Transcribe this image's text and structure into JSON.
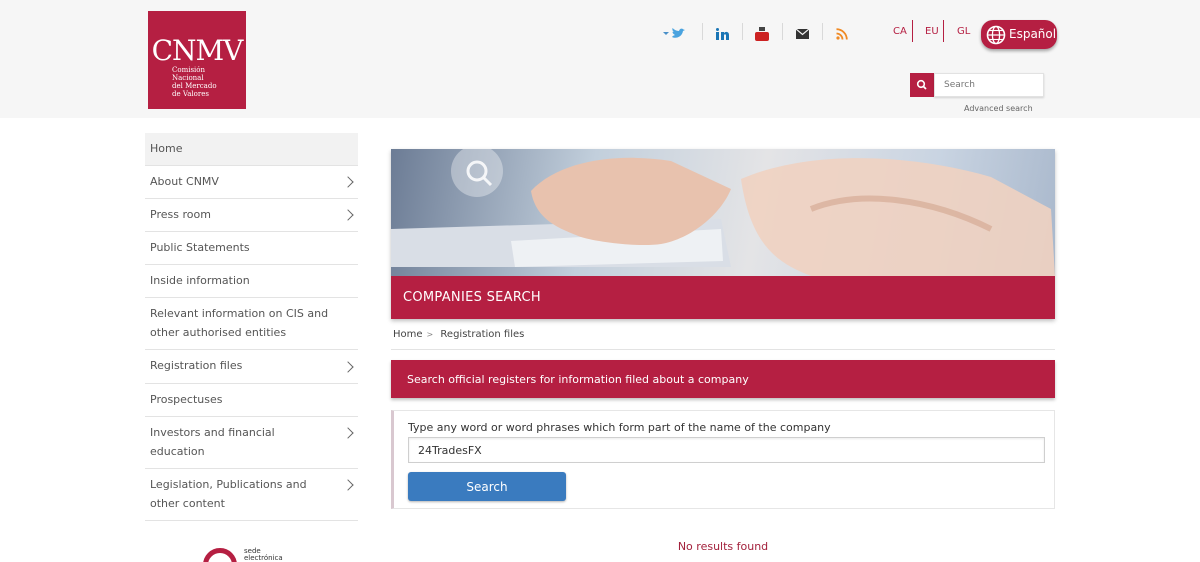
{
  "header": {
    "logo": {
      "acronym": "CNMV",
      "line1": "Comisión",
      "line2": "Nacional",
      "line3": "del Mercado",
      "line4": "de Valores"
    },
    "social_icons": [
      "twitter-icon",
      "linkedin-icon",
      "youtube-icon",
      "mail-icon",
      "rss-icon"
    ],
    "languages": [
      "CA",
      "EU",
      "GL"
    ],
    "language_button": "Español",
    "search_placeholder": "Search",
    "advanced_search": "Advanced search"
  },
  "sidebar": {
    "items": [
      {
        "label": "Home",
        "has_chevron": false
      },
      {
        "label": "About CNMV",
        "has_chevron": true
      },
      {
        "label": "Press room",
        "has_chevron": true
      },
      {
        "label": "Public Statements",
        "has_chevron": false
      },
      {
        "label": "Inside information",
        "has_chevron": false
      },
      {
        "label": "Relevant information on CIS and other authorised entities",
        "has_chevron": false
      },
      {
        "label": "Registration files",
        "has_chevron": true
      },
      {
        "label": "Prospectuses",
        "has_chevron": false
      },
      {
        "label": "Investors and financial education",
        "has_chevron": true
      },
      {
        "label": "Legislation, Publications and other content",
        "has_chevron": true
      }
    ],
    "sede": {
      "line1": "sede",
      "line2": "electrónica"
    }
  },
  "main": {
    "banner_title": "COMPANIES SEARCH",
    "breadcrumb": [
      "Home",
      "Registration files"
    ],
    "notice": "Search official registers for information filed about a company",
    "form": {
      "label": "Type any word or word phrases which form part of the name of the company",
      "value": "24TradesFX",
      "button": "Search"
    },
    "no_results": "No results found"
  },
  "colors": {
    "brand": "#b51f42",
    "button_blue": "#3a7bbf"
  }
}
